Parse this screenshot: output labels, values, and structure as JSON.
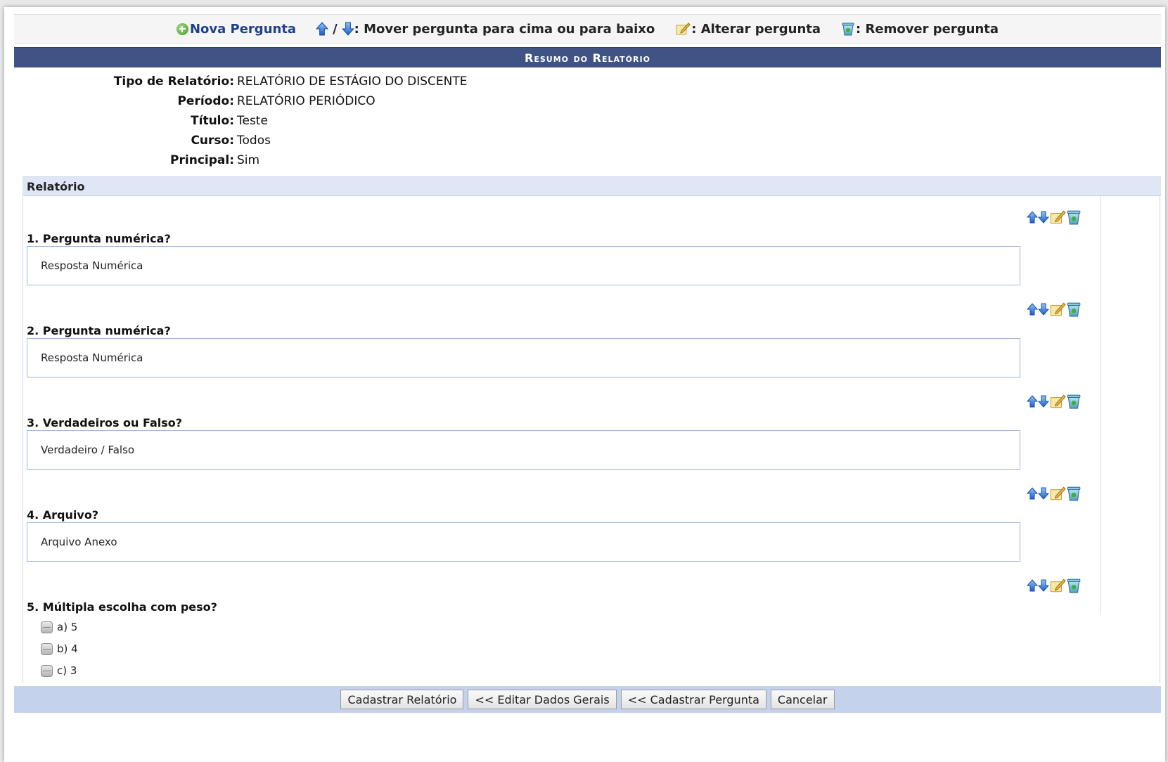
{
  "toolbar": {
    "new_question": "Nova Pergunta",
    "slash": "/",
    "move_desc": ": Mover pergunta para cima ou para baixo",
    "edit_desc": ": Alterar pergunta",
    "remove_desc": ": Remover pergunta"
  },
  "header": {
    "title": "Resumo do Relatório"
  },
  "summary": [
    {
      "label": "Tipo de Relatório:",
      "value": "RELATÓRIO DE ESTÁGIO DO DISCENTE"
    },
    {
      "label": "Período:",
      "value": "RELATÓRIO PERIÓDICO"
    },
    {
      "label": "Título:",
      "value": "Teste"
    },
    {
      "label": "Curso:",
      "value": "Todos"
    },
    {
      "label": "Principal:",
      "value": "Sim"
    }
  ],
  "report": {
    "section_title": "Relatório",
    "questions": [
      {
        "title": "1. Pergunta numérica?",
        "answer": "Resposta Numérica"
      },
      {
        "title": "2. Pergunta numérica?",
        "answer": "Resposta Numérica"
      },
      {
        "title": "3. Verdadeiros ou Falso?",
        "answer": "Verdadeiro / Falso"
      },
      {
        "title": "4. Arquivo?",
        "answer": "Arquivo Anexo"
      },
      {
        "title": "5. Múltipla escolha com peso?",
        "options": [
          "a) 5",
          "b) 4",
          "c) 3"
        ]
      }
    ]
  },
  "footer": {
    "buttons": [
      "Cadastrar Relatório",
      "<< Editar Dados Gerais",
      "<< Cadastrar Pergunta",
      "Cancelar"
    ]
  },
  "colors": {
    "header_bg": "#3f5384",
    "section_bg": "#dfe6f5",
    "footer_bg": "#c5d2ec",
    "link": "#1f3f8e"
  }
}
